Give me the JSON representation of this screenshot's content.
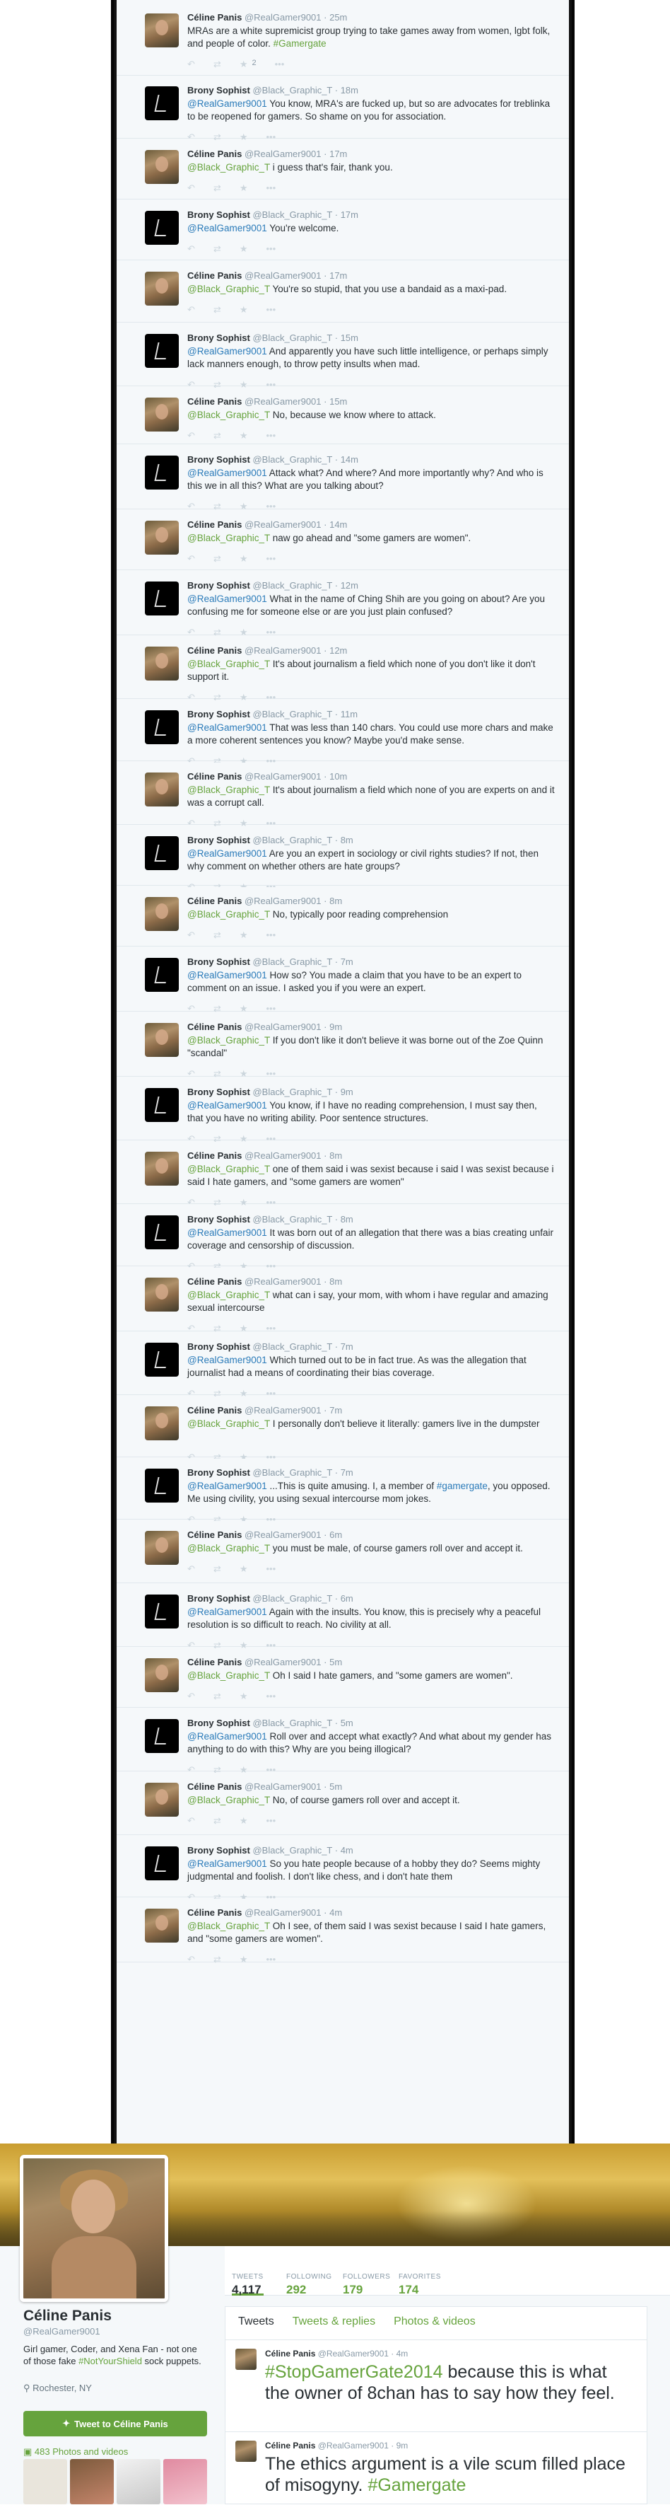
{
  "thread": {
    "tweets": [
      {
        "who": "celine",
        "name": "Céline Panis",
        "handle": "@RealGamer9001",
        "time": "25m",
        "parts": [
          {
            "t": "text",
            "v": "MRAs are a white supremicist group trying to take games away from women, lgbt folk, and people of color. "
          },
          {
            "t": "hashtag",
            "v": "#Gamergate"
          }
        ],
        "fav_count": "2"
      },
      {
        "who": "brony",
        "name": "Brony Sophist",
        "handle": "@Black_Graphic_T",
        "time": "18m",
        "parts": [
          {
            "t": "mention",
            "v": "@RealGamer9001"
          },
          {
            "t": "text",
            "v": " You know, MRA's are fucked up, but so are advocates for treblinka to be reopened for gamers. So shame on you for association."
          }
        ]
      },
      {
        "who": "celine",
        "name": "Céline Panis",
        "handle": "@RealGamer9001",
        "time": "17m",
        "parts": [
          {
            "t": "mention",
            "v": "@Black_Graphic_T"
          },
          {
            "t": "text",
            "v": " i guess that's fair, thank you."
          }
        ]
      },
      {
        "who": "brony",
        "name": "Brony Sophist",
        "handle": "@Black_Graphic_T",
        "time": "17m",
        "parts": [
          {
            "t": "mention",
            "v": "@RealGamer9001"
          },
          {
            "t": "text",
            "v": " You're welcome."
          }
        ]
      },
      {
        "who": "celine",
        "name": "Céline Panis",
        "handle": "@RealGamer9001",
        "time": "17m",
        "parts": [
          {
            "t": "mention",
            "v": "@Black_Graphic_T"
          },
          {
            "t": "text",
            "v": " You're so stupid, that you use a bandaid as a maxi-pad."
          }
        ]
      },
      {
        "who": "brony",
        "name": "Brony Sophist",
        "handle": "@Black_Graphic_T",
        "time": "15m",
        "parts": [
          {
            "t": "mention",
            "v": "@RealGamer9001"
          },
          {
            "t": "text",
            "v": " And apparently you have such little intelligence, or perhaps simply lack manners enough, to throw petty insults when mad."
          }
        ]
      },
      {
        "who": "celine",
        "name": "Céline Panis",
        "handle": "@RealGamer9001",
        "time": "15m",
        "parts": [
          {
            "t": "mention",
            "v": "@Black_Graphic_T"
          },
          {
            "t": "text",
            "v": " No, because we know where to attack."
          }
        ]
      },
      {
        "who": "brony",
        "name": "Brony Sophist",
        "handle": "@Black_Graphic_T",
        "time": "14m",
        "parts": [
          {
            "t": "mention",
            "v": "@RealGamer9001"
          },
          {
            "t": "text",
            "v": " Attack what? And where? And more importantly why? And who is this we in all this? What are you talking about?"
          }
        ]
      },
      {
        "who": "celine",
        "name": "Céline Panis",
        "handle": "@RealGamer9001",
        "time": "14m",
        "parts": [
          {
            "t": "mention",
            "v": "@Black_Graphic_T"
          },
          {
            "t": "text",
            "v": " naw go ahead and \"some gamers are women\"."
          }
        ]
      },
      {
        "who": "brony",
        "name": "Brony Sophist",
        "handle": "@Black_Graphic_T",
        "time": "12m",
        "parts": [
          {
            "t": "mention",
            "v": "@RealGamer9001"
          },
          {
            "t": "text",
            "v": " What in the name of Ching Shih are you going on about? Are you confusing me for someone else or are you just plain confused?"
          }
        ]
      },
      {
        "who": "celine",
        "name": "Céline Panis",
        "handle": "@RealGamer9001",
        "time": "12m",
        "parts": [
          {
            "t": "mention",
            "v": "@Black_Graphic_T"
          },
          {
            "t": "text",
            "v": " It's about journalism a field which none of you don't like it don't support it."
          }
        ]
      },
      {
        "who": "brony",
        "name": "Brony Sophist",
        "handle": "@Black_Graphic_T",
        "time": "11m",
        "parts": [
          {
            "t": "mention",
            "v": "@RealGamer9001"
          },
          {
            "t": "text",
            "v": " That was less than 140 chars. You could use more chars and make a more coherent sentences you know? Maybe you'd make sense."
          }
        ]
      },
      {
        "who": "celine",
        "name": "Céline Panis",
        "handle": "@RealGamer9001",
        "time": "10m",
        "parts": [
          {
            "t": "mention",
            "v": "@Black_Graphic_T"
          },
          {
            "t": "text",
            "v": " It's about journalism a field which none of you are experts on and it was a corrupt call."
          }
        ]
      },
      {
        "who": "brony",
        "name": "Brony Sophist",
        "handle": "@Black_Graphic_T",
        "time": "8m",
        "parts": [
          {
            "t": "mention",
            "v": "@RealGamer9001"
          },
          {
            "t": "text",
            "v": " Are you an expert in sociology or civil rights studies? If not, then why comment on whether others are hate groups?"
          }
        ]
      },
      {
        "who": "celine",
        "name": "Céline Panis",
        "handle": "@RealGamer9001",
        "time": "8m",
        "parts": [
          {
            "t": "mention",
            "v": "@Black_Graphic_T"
          },
          {
            "t": "text",
            "v": " No, typically poor reading comprehension"
          }
        ]
      },
      {
        "who": "brony",
        "name": "Brony Sophist",
        "handle": "@Black_Graphic_T",
        "time": "7m",
        "parts": [
          {
            "t": "mention",
            "v": "@RealGamer9001"
          },
          {
            "t": "text",
            "v": " How so? You made a claim that you have to be an expert to comment on an issue. I asked you if you were an expert."
          }
        ]
      },
      {
        "who": "celine",
        "name": "Céline Panis",
        "handle": "@RealGamer9001",
        "time": "9m",
        "parts": [
          {
            "t": "mention",
            "v": "@Black_Graphic_T"
          },
          {
            "t": "text",
            "v": " If you don't like it don't believe it was borne out of the Zoe Quinn \"scandal\""
          }
        ]
      },
      {
        "who": "brony",
        "name": "Brony Sophist",
        "handle": "@Black_Graphic_T",
        "time": "9m",
        "parts": [
          {
            "t": "mention",
            "v": "@RealGamer9001"
          },
          {
            "t": "text",
            "v": " You know, if I have no reading comprehension, I must say then, that you have no writing ability. Poor sentence structures."
          }
        ]
      },
      {
        "who": "celine",
        "name": "Céline Panis",
        "handle": "@RealGamer9001",
        "time": "8m",
        "parts": [
          {
            "t": "mention",
            "v": "@Black_Graphic_T"
          },
          {
            "t": "text",
            "v": " one of them said i was sexist because i said I was sexist because i said I hate gamers, and \"some gamers are women\""
          }
        ]
      },
      {
        "who": "brony",
        "name": "Brony Sophist",
        "handle": "@Black_Graphic_T",
        "time": "8m",
        "parts": [
          {
            "t": "mention",
            "v": "@RealGamer9001"
          },
          {
            "t": "text",
            "v": " It was born out of an allegation that there was a bias creating unfair coverage and censorship of discussion."
          }
        ]
      },
      {
        "who": "celine",
        "name": "Céline Panis",
        "handle": "@RealGamer9001",
        "time": "8m",
        "parts": [
          {
            "t": "mention",
            "v": "@Black_Graphic_T"
          },
          {
            "t": "text",
            "v": " what can i say, your mom, with whom i have regular and amazing sexual intercourse"
          }
        ]
      },
      {
        "who": "brony",
        "name": "Brony Sophist",
        "handle": "@Black_Graphic_T",
        "time": "7m",
        "parts": [
          {
            "t": "mention",
            "v": "@RealGamer9001"
          },
          {
            "t": "text",
            "v": " Which turned out to be in fact true. As was the allegation that journalist had a means of coordinating their bias coverage."
          }
        ]
      },
      {
        "who": "celine",
        "name": "Céline Panis",
        "handle": "@RealGamer9001",
        "time": "7m",
        "parts": [
          {
            "t": "mention",
            "v": "@Black_Graphic_T"
          },
          {
            "t": "text",
            "v": " I personally don't believe it literally: gamers live in the dumpster"
          }
        ]
      },
      {
        "who": "brony",
        "name": "Brony Sophist",
        "handle": "@Black_Graphic_T",
        "time": "7m",
        "parts": [
          {
            "t": "mention",
            "v": "@RealGamer9001"
          },
          {
            "t": "text",
            "v": " ...This is quite amusing. I, a member of "
          },
          {
            "t": "hashtag",
            "v": "#gamergate"
          },
          {
            "t": "text",
            "v": ", you opposed. Me using civility, you using sexual intercourse mom jokes."
          }
        ]
      },
      {
        "who": "celine",
        "name": "Céline Panis",
        "handle": "@RealGamer9001",
        "time": "6m",
        "parts": [
          {
            "t": "mention",
            "v": "@Black_Graphic_T"
          },
          {
            "t": "text",
            "v": " you must be male, of course gamers roll over and accept it."
          }
        ]
      },
      {
        "who": "brony",
        "name": "Brony Sophist",
        "handle": "@Black_Graphic_T",
        "time": "6m",
        "parts": [
          {
            "t": "mention",
            "v": "@RealGamer9001"
          },
          {
            "t": "text",
            "v": " Again with the insults. You know, this is precisely why a peaceful resolution is so difficult to reach. No civility at all."
          }
        ]
      },
      {
        "who": "celine",
        "name": "Céline Panis",
        "handle": "@RealGamer9001",
        "time": "5m",
        "parts": [
          {
            "t": "mention",
            "v": "@Black_Graphic_T"
          },
          {
            "t": "text",
            "v": " Oh I said I hate gamers, and \"some gamers are women\"."
          }
        ]
      },
      {
        "who": "brony",
        "name": "Brony Sophist",
        "handle": "@Black_Graphic_T",
        "time": "5m",
        "parts": [
          {
            "t": "mention",
            "v": "@RealGamer9001"
          },
          {
            "t": "text",
            "v": " Roll over and accept what exactly? And what about my gender has anything to do with this? Why are you being illogical?"
          }
        ]
      },
      {
        "who": "celine",
        "name": "Céline Panis",
        "handle": "@RealGamer9001",
        "time": "5m",
        "parts": [
          {
            "t": "mention",
            "v": "@Black_Graphic_T"
          },
          {
            "t": "text",
            "v": " No, of course gamers roll over and accept it."
          }
        ]
      },
      {
        "who": "brony",
        "name": "Brony Sophist",
        "handle": "@Black_Graphic_T",
        "time": "4m",
        "parts": [
          {
            "t": "mention",
            "v": "@RealGamer9001"
          },
          {
            "t": "text",
            "v": " So you hate people because of a hobby they do? Seems mighty judgmental and foolish. I don't like chess, and i don't hate them"
          }
        ]
      },
      {
        "who": "celine",
        "name": "Céline Panis",
        "handle": "@RealGamer9001",
        "time": "4m",
        "parts": [
          {
            "t": "mention",
            "v": "@Black_Graphic_T"
          },
          {
            "t": "text",
            "v": " Oh I see, of them said I was sexist because I said I hate gamers, and \"some gamers are women\"."
          }
        ]
      }
    ]
  },
  "icons": {
    "reply": "reply-icon",
    "retweet": "retweet-icon",
    "favorite": "star-icon",
    "more": "more-icon",
    "location": "location-pin-icon",
    "tweet_button": "bird-icon",
    "photos": "camera-icon"
  },
  "colors": {
    "accent": "#66a33d",
    "link_blue": "#2b7bb9",
    "background": "#f5f8fa"
  },
  "profile": {
    "name": "Céline Panis",
    "handle": "@RealGamer9001",
    "bio_parts": [
      {
        "t": "text",
        "v": "Girl gamer, Coder, and Xena Fan - not one of those fake "
      },
      {
        "t": "hashtag",
        "v": "#NotYourShield"
      },
      {
        "t": "text",
        "v": " sock puppets."
      }
    ],
    "location": "Rochester, NY",
    "tweet_button_label": "Tweet to Céline Panis",
    "photos_label": "483 Photos and videos",
    "stats": [
      {
        "label": "TWEETS",
        "value": "4,117"
      },
      {
        "label": "FOLLOWING",
        "value": "292"
      },
      {
        "label": "FOLLOWERS",
        "value": "179"
      },
      {
        "label": "FAVORITES",
        "value": "174"
      }
    ],
    "tabs": [
      "Tweets",
      "Tweets & replies",
      "Photos & videos"
    ],
    "tweets": [
      {
        "name": "Céline Panis",
        "handle": "@RealGamer9001",
        "time": "4m",
        "parts": [
          {
            "t": "hashtag",
            "v": "#StopGamerGate2014"
          },
          {
            "t": "text",
            "v": " because this is what the owner of 8chan has to say how they feel."
          }
        ]
      },
      {
        "name": "Céline Panis",
        "handle": "@RealGamer9001",
        "time": "9m",
        "parts": [
          {
            "t": "text",
            "v": "The ethics argument is a vile scum filled place of misogyny. "
          },
          {
            "t": "hashtag",
            "v": "#Gamergate"
          }
        ]
      }
    ]
  }
}
